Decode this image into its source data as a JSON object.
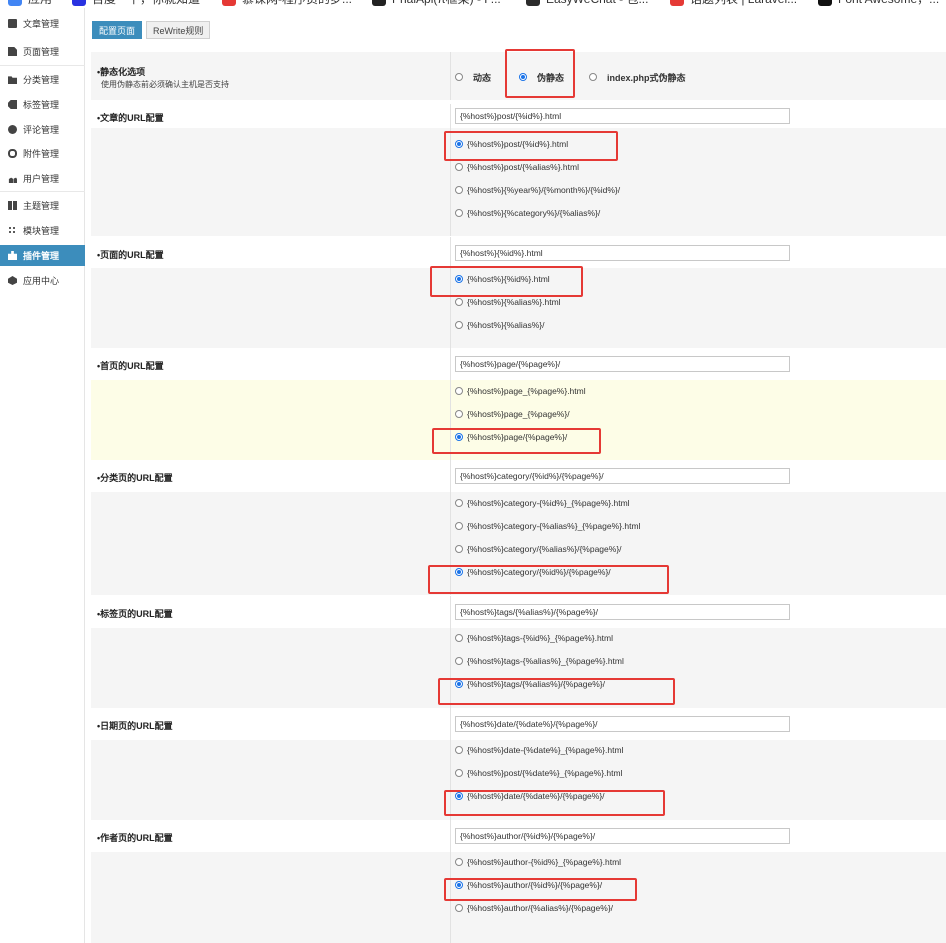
{
  "bookmarks": [
    {
      "label": "应用",
      "color": "#4285f4"
    },
    {
      "label": "百度一下，你就知道",
      "color": "#2932e1"
    },
    {
      "label": "慕课网-程序员的梦...",
      "color": "#e53935"
    },
    {
      "label": "PhalApi(π框架) - P...",
      "color": "#222222"
    },
    {
      "label": "EasyWeChat - 包...",
      "color": "#2b2b2b"
    },
    {
      "label": "话题列表 | Laravel...",
      "color": "#e53935"
    },
    {
      "label": "Font Awesome，...",
      "color": "#111111"
    }
  ],
  "sidebar": {
    "items": [
      {
        "label": "文章管理",
        "icon": "article-icon"
      },
      {
        "label": "页面管理",
        "icon": "page-icon"
      },
      {
        "label": "分类管理",
        "icon": "folder-icon"
      },
      {
        "label": "标签管理",
        "icon": "tag-icon"
      },
      {
        "label": "评论管理",
        "icon": "comment-icon"
      },
      {
        "label": "附件管理",
        "icon": "attachment-icon"
      },
      {
        "label": "用户管理",
        "icon": "users-icon"
      },
      {
        "label": "主题管理",
        "icon": "theme-icon"
      },
      {
        "label": "模块管理",
        "icon": "module-icon"
      },
      {
        "label": "插件管理",
        "icon": "puzzle-icon",
        "active": true
      },
      {
        "label": "应用中心",
        "icon": "app-center-icon"
      }
    ]
  },
  "tabs": [
    {
      "label": "配置页面",
      "active": true
    },
    {
      "label": "ReWrite规则",
      "active": false
    }
  ],
  "mode": {
    "label": "•静态化选项",
    "note": "使用伪静态前必须确认主机是否支持",
    "options": [
      {
        "label": "动态",
        "checked": false
      },
      {
        "label": "伪静态",
        "checked": true
      },
      {
        "label": "index.php式伪静态",
        "checked": false
      }
    ]
  },
  "sections": [
    {
      "label": "•文章的URL配置",
      "value": "{%host%}post/{%id%}.html",
      "options": [
        {
          "label": "{%host%}post/{%id%}.html",
          "checked": true
        },
        {
          "label": "{%host%}post/{%alias%}.html",
          "checked": false
        },
        {
          "label": "{%host%}{%year%}/{%month%}/{%id%}/",
          "checked": false
        },
        {
          "label": "{%host%}{%category%}/{%alias%}/",
          "checked": false
        }
      ]
    },
    {
      "label": "•页面的URL配置",
      "value": "{%host%}{%id%}.html",
      "options": [
        {
          "label": "{%host%}{%id%}.html",
          "checked": true
        },
        {
          "label": "{%host%}{%alias%}.html",
          "checked": false
        },
        {
          "label": "{%host%}{%alias%}/",
          "checked": false
        }
      ]
    },
    {
      "label": "•首页的URL配置",
      "value": "{%host%}page/{%page%}/",
      "highlight": true,
      "options": [
        {
          "label": "{%host%}page_{%page%}.html",
          "checked": false
        },
        {
          "label": "{%host%}page_{%page%}/",
          "checked": false
        },
        {
          "label": "{%host%}page/{%page%}/",
          "checked": true
        }
      ]
    },
    {
      "label": "•分类页的URL配置",
      "value": "{%host%}category/{%id%}/{%page%}/",
      "options": [
        {
          "label": "{%host%}category-{%id%}_{%page%}.html",
          "checked": false
        },
        {
          "label": "{%host%}category-{%alias%}_{%page%}.html",
          "checked": false
        },
        {
          "label": "{%host%}category/{%alias%}/{%page%}/",
          "checked": false
        },
        {
          "label": "{%host%}category/{%id%}/{%page%}/",
          "checked": true
        }
      ]
    },
    {
      "label": "•标签页的URL配置",
      "value": "{%host%}tags/{%alias%}/{%page%}/",
      "options": [
        {
          "label": "{%host%}tags-{%id%}_{%page%}.html",
          "checked": false
        },
        {
          "label": "{%host%}tags-{%alias%}_{%page%}.html",
          "checked": false
        },
        {
          "label": "{%host%}tags/{%alias%}/{%page%}/",
          "checked": true
        }
      ]
    },
    {
      "label": "•日期页的URL配置",
      "value": "{%host%}date/{%date%}/{%page%}/",
      "options": [
        {
          "label": "{%host%}date-{%date%}_{%page%}.html",
          "checked": false
        },
        {
          "label": "{%host%}post/{%date%}_{%page%}.html",
          "checked": false
        },
        {
          "label": "{%host%}date/{%date%}/{%page%}/",
          "checked": true
        }
      ]
    },
    {
      "label": "•作者页的URL配置",
      "value": "{%host%}author/{%id%}/{%page%}/",
      "options": [
        {
          "label": "{%host%}author-{%id%}_{%page%}.html",
          "checked": false
        },
        {
          "label": "{%host%}author/{%id%}/{%page%}/",
          "checked": true
        },
        {
          "label": "{%host%}author/{%alias%}/{%page%}/",
          "checked": false
        }
      ]
    }
  ]
}
